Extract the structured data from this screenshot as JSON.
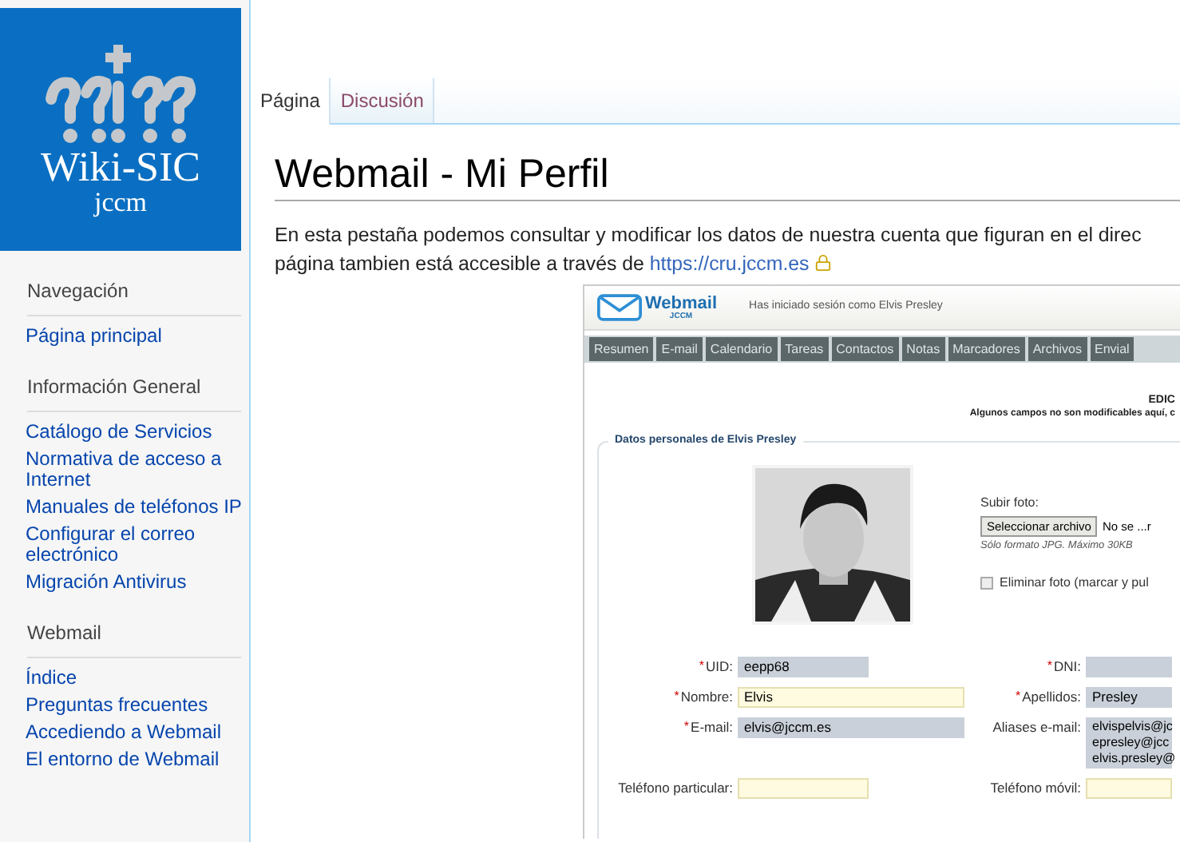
{
  "logo": {
    "name": "Wiki-SIC",
    "sub": "jccm"
  },
  "sidebar": {
    "sections": [
      {
        "heading": "Navegación",
        "items": [
          "Página principal"
        ]
      },
      {
        "heading": "Información General",
        "items": [
          "Catálogo de Servicios",
          "Normativa de acceso a Internet",
          "Manuales de teléfonos IP",
          "Configurar el correo electrónico",
          "Migración Antivirus"
        ]
      },
      {
        "heading": "Webmail",
        "items": [
          "Índice",
          "Preguntas frecuentes",
          "Accediendo a Webmail",
          "El entorno de Webmail"
        ]
      }
    ]
  },
  "tabs": [
    {
      "label": "Página",
      "selected": true
    },
    {
      "label": "Discusión",
      "selected": false
    }
  ],
  "page": {
    "title": "Webmail - Mi Perfil",
    "intro_line_1": "En esta pestaña podemos consultar y modificar los datos de nuestra cuenta que figuran en el direc",
    "intro_line_2": "página tambien está accesible a través de",
    "link": "https://cru.jccm.es"
  },
  "screenshot": {
    "logo": "Webmail",
    "logo_sub": "JCCM",
    "session": "Has iniciado sesión como Elvis Presley",
    "nav": [
      "Resumen",
      "E-mail",
      "Calendario",
      "Tareas",
      "Contactos",
      "Notas",
      "Marcadores",
      "Archivos",
      "Envial"
    ],
    "heading": "EDIC",
    "note": "Algunos campos no son modificables aquí, c",
    "fieldset": "Datos personales de Elvis Presley",
    "upload_label": "Subir foto:",
    "upload_button": "Seleccionar archivo",
    "upload_status": "No se ...r",
    "upload_hint": "Sólo formato JPG. Máximo 30KB",
    "delete_photo": {
      "label": "Eliminar foto (marcar y pul",
      "checked": false
    },
    "rows": [
      {
        "left": {
          "mark": "*",
          "label": "UID:",
          "editable": false,
          "value": "eepp68"
        },
        "right": {
          "mark": "*",
          "label": "DNI:",
          "editable": false
        }
      },
      {
        "left": {
          "mark": "*",
          "label": "Nombre:",
          "editable": true,
          "value": "Elvis"
        },
        "right": {
          "mark": "*",
          "label": "Apellidos:",
          "editable": false,
          "value": "Presley"
        }
      },
      {
        "left": {
          "mark": "*",
          "label": "E-mail:",
          "editable": false,
          "value": "elvis@jccm.es"
        },
        "right": {
          "label": "Aliases e-mail:",
          "editable": false,
          "lines": [
            "elvispelvis@jc",
            "epresley@jcc",
            "elvis.presley@"
          ]
        }
      },
      {
        "left": {
          "label": "Teléfono particular:",
          "editable": true
        },
        "right": {
          "label": "Teléfono móvil:",
          "editable": true
        }
      }
    ]
  }
}
